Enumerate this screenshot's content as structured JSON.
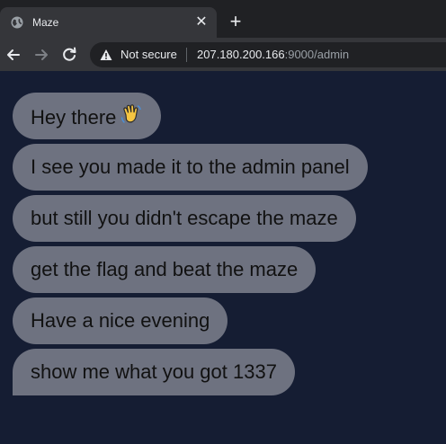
{
  "browser": {
    "tab": {
      "title": "Maze",
      "favicon": "globe-icon",
      "close_glyph": "✕"
    },
    "new_tab_glyph": "+",
    "nav": {
      "back": "back-arrow-icon",
      "forward": "forward-arrow-icon",
      "reload": "reload-icon"
    },
    "address": {
      "security_label": "Not secure",
      "url_host": "207.180.200.166",
      "url_rest": ":9000/admin"
    }
  },
  "chat": {
    "messages": [
      {
        "text": "Hey there",
        "emoji": "waving-hand-icon"
      },
      {
        "text": "I see you made it to the admin panel"
      },
      {
        "text": "but still you didn't escape the maze"
      },
      {
        "text": "get the flag and beat the maze"
      },
      {
        "text": "Have a nice evening"
      },
      {
        "text": "show me what you got 1337"
      }
    ]
  },
  "colors": {
    "page_background": "#151d33",
    "bubble_background": "#6e7280",
    "bubble_text": "#111111",
    "chrome_dark": "#202124",
    "chrome_toolbar": "#35363a"
  }
}
